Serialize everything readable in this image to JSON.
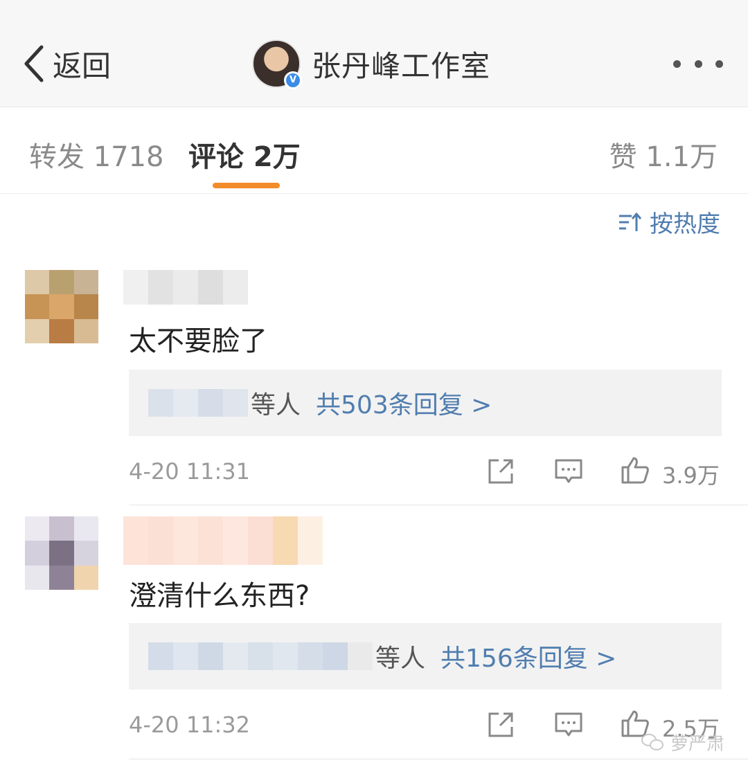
{
  "header": {
    "back_label": "返回",
    "title": "张丹峰工作室",
    "verified_mark": "V"
  },
  "tabs": [
    {
      "label": "转发 1718",
      "active": false
    },
    {
      "label": "评论 2万",
      "active": true
    },
    {
      "label": "赞 1.1万",
      "active": false
    }
  ],
  "sort": {
    "label": "按热度"
  },
  "accent_color": "#f28c28",
  "link_color": "#507daf",
  "comments": [
    {
      "text": "太不要脸了",
      "reply_suffix": "等人",
      "reply_count_label": "共503条回复 >",
      "time": "4-20 11:31",
      "likes": "3.9万"
    },
    {
      "text": "澄清什么东西?",
      "reply_suffix": "等人",
      "reply_count_label": "共156条回复 >",
      "time": "4-20 11:32",
      "likes": "2.5万"
    }
  ],
  "watermark": {
    "label": "萝严肃"
  },
  "icons": [
    "chevron-left-icon",
    "more-icon",
    "sort-icon",
    "share-icon",
    "comment-icon",
    "like-icon",
    "wechat-icon"
  ]
}
